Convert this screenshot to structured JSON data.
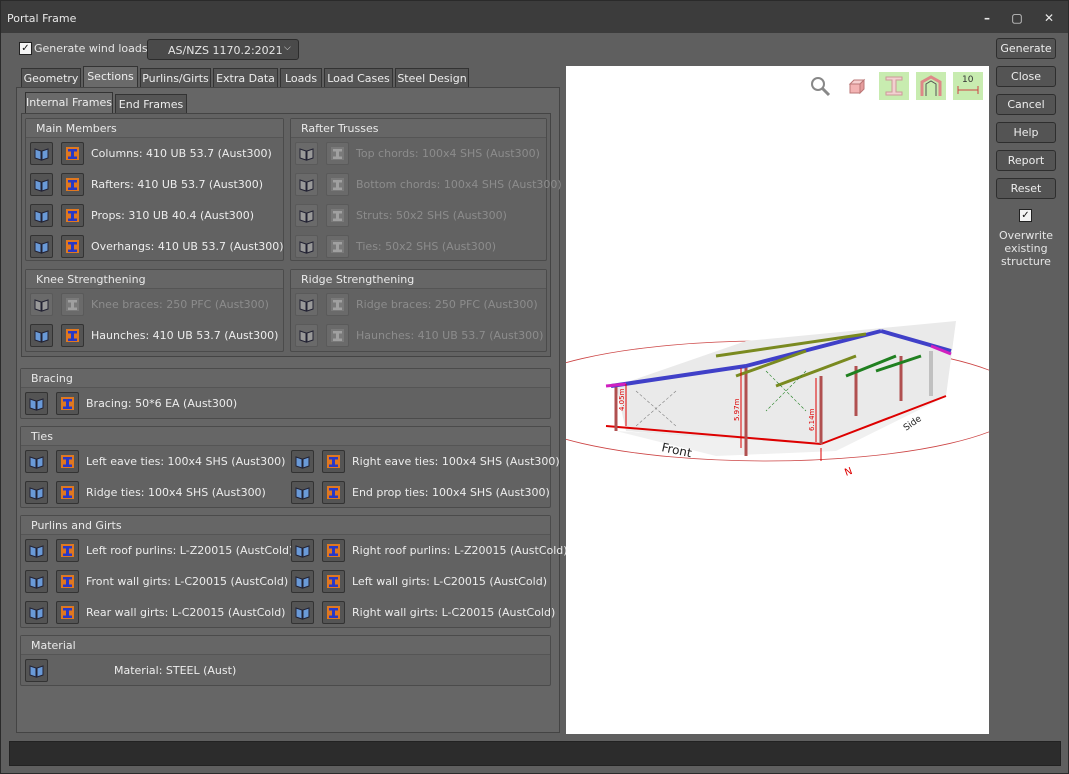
{
  "window": {
    "title": "Portal Frame"
  },
  "wind": {
    "label": "Generate wind loads:",
    "checked": "✓",
    "standard": "AS/NZS 1170.2:2021"
  },
  "tabs": [
    "Geometry",
    "Sections",
    "Purlins/Girts",
    "Extra Data",
    "Loads",
    "Load Cases",
    "Steel Design"
  ],
  "subtabs": [
    "Internal Frames",
    "End Frames"
  ],
  "groups": {
    "main": {
      "title": "Main Members",
      "rows": [
        "Columns: 410 UB 53.7 (Aust300)",
        "Rafters: 410 UB 53.7 (Aust300)",
        "Props: 310 UB 40.4 (Aust300)",
        "Overhangs: 410 UB 53.7 (Aust300)"
      ]
    },
    "trusses": {
      "title": "Rafter Trusses",
      "rows": [
        "Top chords: 100x4 SHS (Aust300)",
        "Bottom chords: 100x4 SHS (Aust300)",
        "Struts: 50x2 SHS (Aust300)",
        "Ties: 50x2 SHS (Aust300)"
      ]
    },
    "knee": {
      "title": "Knee Strengthening",
      "rows": [
        "Knee braces: 250 PFC (Aust300)",
        "Haunches: 410 UB 53.7 (Aust300)"
      ]
    },
    "ridge": {
      "title": "Ridge Strengthening",
      "rows": [
        "Ridge braces: 250 PFC (Aust300)",
        "Haunches: 410 UB 53.7 (Aust300)"
      ]
    },
    "bracing": {
      "title": "Bracing",
      "rows": [
        "Bracing: 50*6 EA (Aust300)"
      ]
    },
    "ties": {
      "title": "Ties",
      "rows": [
        "Left eave ties: 100x4 SHS (Aust300)",
        "Right eave ties: 100x4 SHS (Aust300)",
        "Ridge ties: 100x4 SHS (Aust300)",
        "End prop ties: 100x4 SHS (Aust300)"
      ]
    },
    "purlins": {
      "title": "Purlins and Girts",
      "rows": [
        "Left roof purlins: L-Z20015 (AustCold)",
        "Right roof purlins: L-Z20015 (AustCold)",
        "Front wall girts: L-C20015 (AustCold)",
        "Left wall girts: L-C20015 (AustCold)",
        "Rear wall girts: L-C20015 (AustCold)",
        "Right wall girts: L-C20015 (AustCold)"
      ]
    },
    "material": {
      "title": "Material",
      "rows": [
        "Material: STEEL (Aust)"
      ]
    }
  },
  "side_buttons": [
    "Generate",
    "Close",
    "Cancel",
    "Help",
    "Report",
    "Reset"
  ],
  "overwrite": {
    "checked": "✓",
    "label": "Overwrite existing structure"
  },
  "view": {
    "toolbar_scale": "10",
    "labels": {
      "front": "Front",
      "side": "Side",
      "north": "N",
      "h1": "4.05m",
      "h2": "5.97m",
      "h3": "6.14m"
    }
  },
  "colors": {
    "rafter": "#4040c8",
    "purlin": "#7a8a20",
    "column": "#b05050",
    "dim": "#d00000",
    "magenta": "#d020c0",
    "green": "#208020"
  }
}
